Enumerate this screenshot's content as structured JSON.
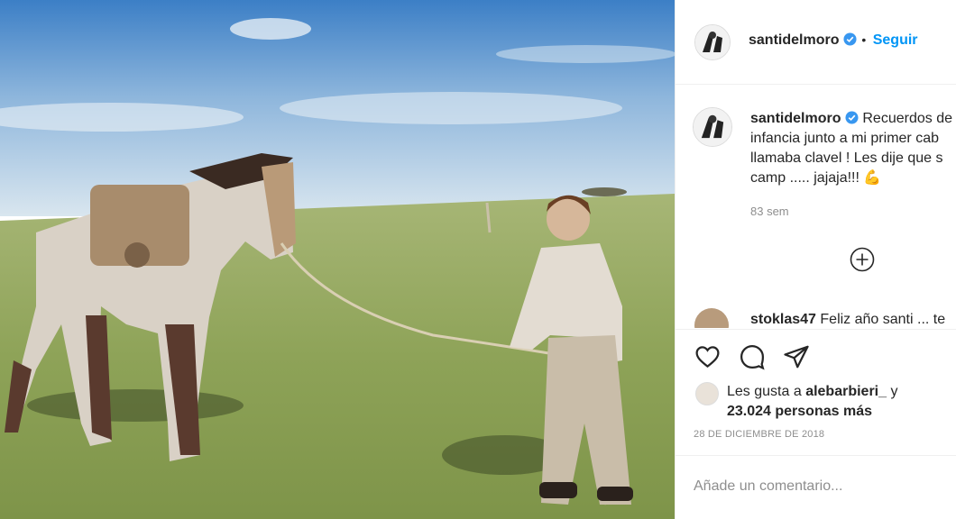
{
  "header": {
    "username": "santidelmoro",
    "separator": "•",
    "follow_label": "Seguir"
  },
  "caption": {
    "username": "santidelmoro",
    "lines": [
      "Recuerdos de",
      "infancia junto a mi primer cab",
      "llamaba clavel ! Les dije que s",
      "camp ..... jajaja!!! 💪"
    ],
    "time": "83 sem"
  },
  "comment": {
    "username": "stoklas47",
    "text": "Feliz año santi ... te"
  },
  "likes": {
    "line1_prefix": "Les gusta a",
    "line1_user": "alebarbieri_",
    "line1_suffix": "y",
    "line2": "23.024 personas más"
  },
  "date": "28 DE DICIEMBRE DE 2018",
  "add_comment_placeholder": "Añade un comentario...",
  "colors": {
    "link": "#0095f6",
    "verified": "#3897f0",
    "text": "#262626",
    "muted": "#8e8e8e"
  },
  "icons": [
    "heart-icon",
    "comment-icon",
    "share-icon",
    "verified-icon",
    "plus-circle-icon"
  ]
}
